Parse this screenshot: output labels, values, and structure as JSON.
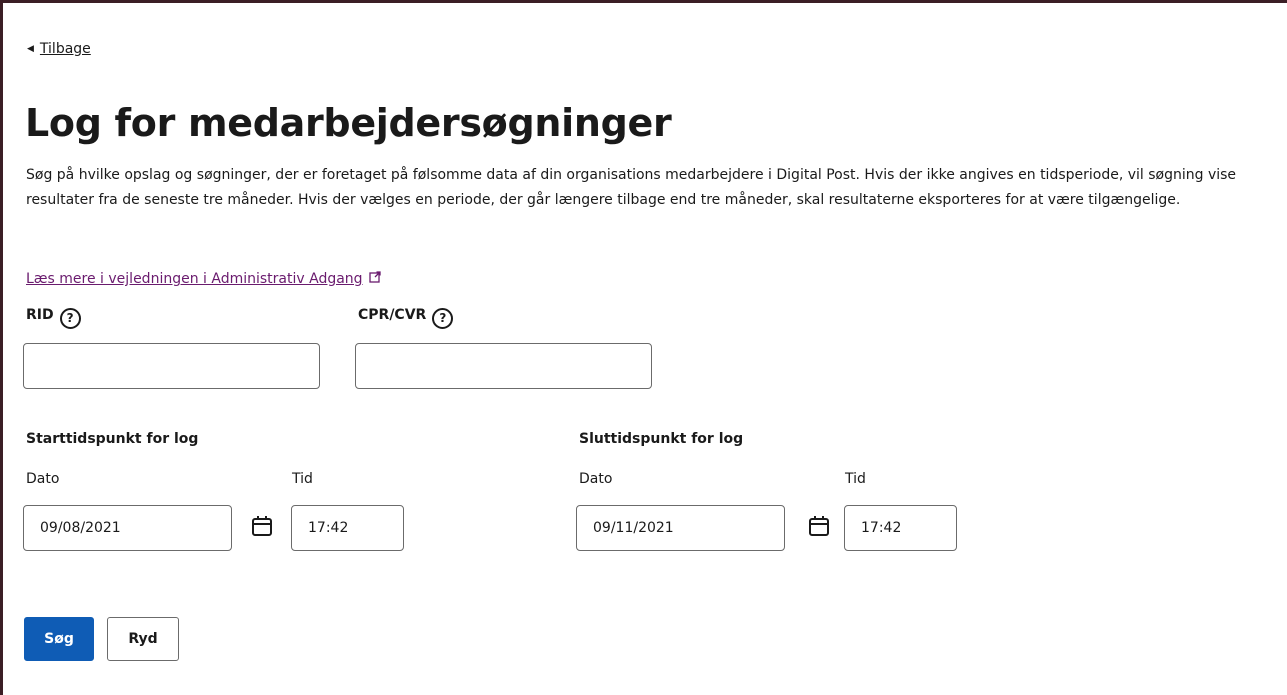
{
  "back": {
    "label": "Tilbage"
  },
  "page": {
    "title": "Log for medarbejdersøgninger",
    "description": "Søg på hvilke opslag og søgninger, der er foretaget på følsomme data af din organisations medarbejdere i Digital Post. Hvis der ikke angives en tidsperiode, vil søgning vise resultater fra de seneste tre måneder. Hvis der vælges en periode, der går længere tilbage end tre måneder, skal resultaterne eksporteres for at være tilgængelige.",
    "guide_link": "Læs mere i vejledningen i Administrativ Adgang"
  },
  "fields": {
    "rid": {
      "label": "RID",
      "value": ""
    },
    "cpr": {
      "label": "CPR/CVR",
      "value": ""
    }
  },
  "start": {
    "heading": "Starttidspunkt for log",
    "date_label": "Dato",
    "date_value": "09/08/2021",
    "time_label": "Tid",
    "time_value": "17:42"
  },
  "end": {
    "heading": "Sluttidspunkt for log",
    "date_label": "Dato",
    "date_value": "09/11/2021",
    "time_label": "Tid",
    "time_value": "17:42"
  },
  "buttons": {
    "search": "Søg",
    "clear": "Ryd"
  },
  "icons": {
    "back": "caret-left-icon",
    "external": "external-link-icon",
    "help": "question-circle-icon",
    "calendar": "calendar-icon"
  },
  "colors": {
    "primary": "#0f5cb5",
    "link": "#6a1b6e",
    "frame": "#3b1e25"
  }
}
